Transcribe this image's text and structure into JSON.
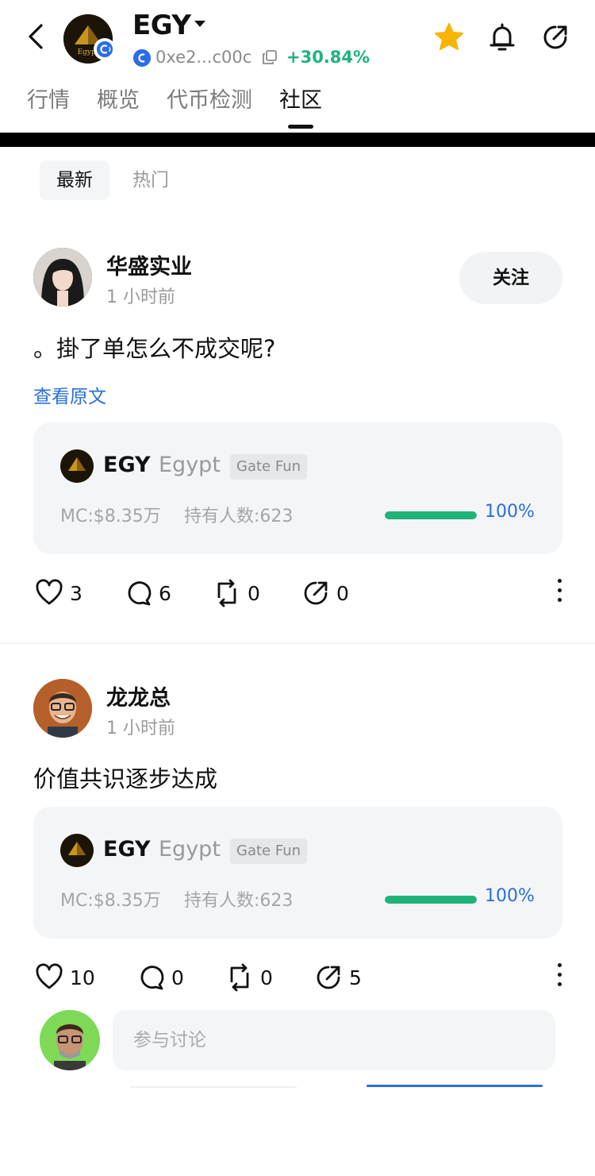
{
  "header": {
    "token_symbol": "EGY",
    "address": "0xe2...c00c",
    "change": "+30.84%",
    "logo_text": "Egypt",
    "colors": {
      "positive": "#1fb37a",
      "star": "#f7b500",
      "link": "#2a6fd8"
    }
  },
  "tabs": [
    {
      "label": "行情"
    },
    {
      "label": "概览"
    },
    {
      "label": "代币检测"
    },
    {
      "label": "社区",
      "active": true
    }
  ],
  "filters": [
    {
      "label": "最新",
      "active": true
    },
    {
      "label": "热门"
    }
  ],
  "posts": [
    {
      "author": "华盛实业",
      "time": "1 小时前",
      "follow_label": "关注",
      "content": "。掛了单怎么不成交呢?",
      "view_original": "查看原文",
      "card": {
        "symbol": "EGY",
        "name": "Egypt",
        "tag": "Gate Fun",
        "mc": "MC:$8.35万",
        "holders": "持有人数:623",
        "progress": 1.0,
        "progress_label": "100%"
      },
      "actions": {
        "likes": "3",
        "comments": "6",
        "reposts": "0",
        "shares": "0"
      }
    },
    {
      "author": "龙龙总",
      "time": "1 小时前",
      "content": "价值共识逐步达成",
      "card": {
        "symbol": "EGY",
        "name": "Egypt",
        "tag": "Gate Fun",
        "mc": "MC:$8.35万",
        "holders": "持有人数:623",
        "progress": 1.0,
        "progress_label": "100%"
      },
      "actions": {
        "likes": "10",
        "comments": "0",
        "reposts": "0",
        "shares": "5"
      }
    }
  ],
  "comment_bar": {
    "placeholder": "参与讨论"
  }
}
